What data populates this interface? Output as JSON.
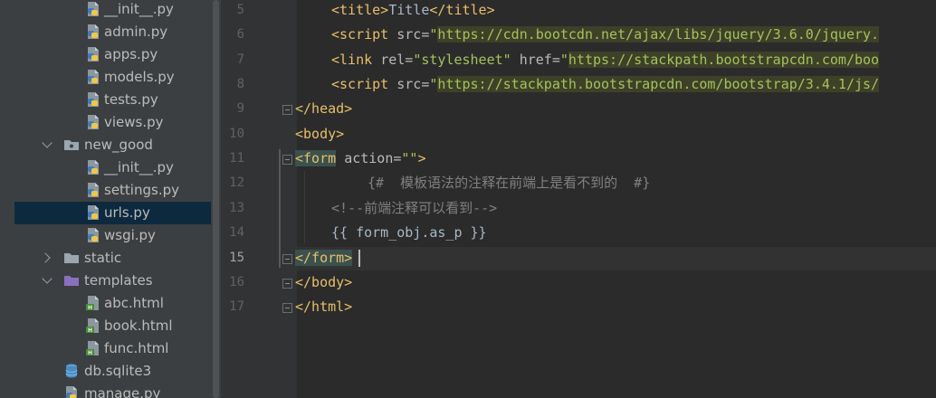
{
  "project_tree": {
    "items": [
      {
        "label": "__init__.py",
        "icon": "python-file-icon",
        "type": "file"
      },
      {
        "label": "admin.py",
        "icon": "python-file-icon",
        "type": "file"
      },
      {
        "label": "apps.py",
        "icon": "python-file-icon",
        "type": "file"
      },
      {
        "label": "models.py",
        "icon": "python-file-icon",
        "type": "file"
      },
      {
        "label": "tests.py",
        "icon": "python-file-icon",
        "type": "file"
      },
      {
        "label": "views.py",
        "icon": "python-file-icon",
        "type": "file"
      },
      {
        "label": "new_good",
        "icon": "package-folder-icon",
        "type": "folder",
        "expanded": true
      },
      {
        "label": "__init__.py",
        "icon": "python-file-icon",
        "type": "file"
      },
      {
        "label": "settings.py",
        "icon": "python-file-icon",
        "type": "file"
      },
      {
        "label": "urls.py",
        "icon": "python-file-icon",
        "type": "file",
        "selected": true
      },
      {
        "label": "wsgi.py",
        "icon": "python-file-icon",
        "type": "file"
      },
      {
        "label": "static",
        "icon": "folder-icon",
        "type": "folder",
        "expanded": false
      },
      {
        "label": "templates",
        "icon": "templates-folder-icon",
        "type": "folder",
        "expanded": true
      },
      {
        "label": "abc.html",
        "icon": "html-file-icon",
        "type": "file"
      },
      {
        "label": "book.html",
        "icon": "html-file-icon",
        "type": "file"
      },
      {
        "label": "func.html",
        "icon": "html-file-icon",
        "type": "file"
      },
      {
        "label": "db.sqlite3",
        "icon": "database-icon",
        "type": "file"
      },
      {
        "label": "manage.py",
        "icon": "python-file-icon",
        "type": "file"
      }
    ]
  },
  "editor": {
    "current_line": 15,
    "lines": [
      {
        "number": "5",
        "segments": [
          {
            "t": "<title>",
            "c": "tag"
          },
          {
            "t": "Title",
            "c": "tpl"
          },
          {
            "t": "</title>",
            "c": "tag"
          }
        ]
      },
      {
        "number": "6",
        "segments": [
          {
            "t": "<script ",
            "c": "tag"
          },
          {
            "t": "src=",
            "c": "attr"
          },
          {
            "t": "\"",
            "c": "str"
          },
          {
            "t": "https://cdn.bootcdn.net/ajax/libs/jquery/3.6.0/jquery.",
            "c": "url"
          }
        ]
      },
      {
        "number": "7",
        "segments": [
          {
            "t": "<link ",
            "c": "tag"
          },
          {
            "t": "rel=",
            "c": "attr"
          },
          {
            "t": "\"stylesheet\" ",
            "c": "str"
          },
          {
            "t": "href=",
            "c": "attr"
          },
          {
            "t": "\"",
            "c": "str"
          },
          {
            "t": "https://stackpath.bootstrapcdn.com/boo",
            "c": "url"
          }
        ]
      },
      {
        "number": "8",
        "segments": [
          {
            "t": "<script ",
            "c": "tag"
          },
          {
            "t": "src=",
            "c": "attr"
          },
          {
            "t": "\"",
            "c": "str"
          },
          {
            "t": "https://stackpath.bootstrapcdn.com/bootstrap/3.4.1/js/",
            "c": "url"
          }
        ]
      },
      {
        "number": "9",
        "segments": [
          {
            "t": "</head>",
            "c": "tag"
          }
        ]
      },
      {
        "number": "10",
        "segments": [
          {
            "t": "<body>",
            "c": "tag"
          }
        ]
      },
      {
        "number": "11",
        "segments": [
          {
            "t": "<form",
            "c": "sel-tag"
          },
          {
            "t": " ",
            "c": "tpl"
          },
          {
            "t": "action=",
            "c": "attr"
          },
          {
            "t": "\"\"",
            "c": "str"
          },
          {
            "t": ">",
            "c": "tag"
          }
        ]
      },
      {
        "number": "12",
        "segments": [
          {
            "t": "{#  模板语法的注释在前端上是看不到的  #}",
            "c": "cmt"
          }
        ]
      },
      {
        "number": "13",
        "segments": [
          {
            "t": "<!--前端注释可以看到-->",
            "c": "cmt"
          }
        ]
      },
      {
        "number": "14",
        "segments": [
          {
            "t": "{{ form_obj.as_p }}",
            "c": "tpl"
          }
        ]
      },
      {
        "number": "15",
        "segments": [
          {
            "t": "</form>",
            "c": "sel-tag"
          }
        ]
      },
      {
        "number": "16",
        "segments": [
          {
            "t": "</body>",
            "c": "tag"
          }
        ]
      },
      {
        "number": "17",
        "segments": [
          {
            "t": "</html>",
            "c": "tag"
          }
        ]
      }
    ]
  },
  "colors": {
    "tree_background": "#3c3f41",
    "editor_background": "#2b2b2b",
    "gutter_background": "#313335",
    "selection": "#0d293e",
    "tag": "#e8bf6a",
    "string": "#a5c25c",
    "comment": "#808080"
  }
}
